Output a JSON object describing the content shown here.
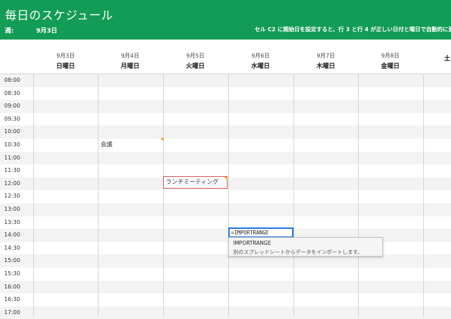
{
  "banner": {
    "title": "毎日のスケジュール",
    "week_label": "週:",
    "week_value": "9月3日",
    "hint": "セル C2 に開始日を設定すると、行 3 と行 4 が正しい日付と曜日で自動的に更"
  },
  "days": [
    {
      "date": "9月3日",
      "weekday": "日曜日"
    },
    {
      "date": "9月4日",
      "weekday": "月曜日"
    },
    {
      "date": "9月5日",
      "weekday": "火曜日"
    },
    {
      "date": "9月6日",
      "weekday": "水曜日"
    },
    {
      "date": "9月7日",
      "weekday": "木曜日"
    },
    {
      "date": "9月8日",
      "weekday": "金曜日"
    },
    {
      "date": "",
      "weekday": "土"
    }
  ],
  "times": [
    "08:00",
    "08:30",
    "09:00",
    "09:30",
    "10:00",
    "10:30",
    "11:00",
    "11:30",
    "12:00",
    "12:30",
    "13:00",
    "13:30",
    "14:00",
    "14:30",
    "15:00",
    "15:30",
    "16:00",
    "16:30",
    "17:00"
  ],
  "events": {
    "meeting": "会議",
    "lunch": "ランチミーティング"
  },
  "editor": {
    "formula": "=IMPORTRANGE",
    "tooltip_name": "IMPORTRANGE",
    "tooltip_desc": "別のスプレッドシートからデータをインポートします。"
  },
  "colors": {
    "banner": "#129c55",
    "row_shade": "#f3f3f3",
    "selection": "#1a73e8",
    "event_border": "#d9534f"
  }
}
